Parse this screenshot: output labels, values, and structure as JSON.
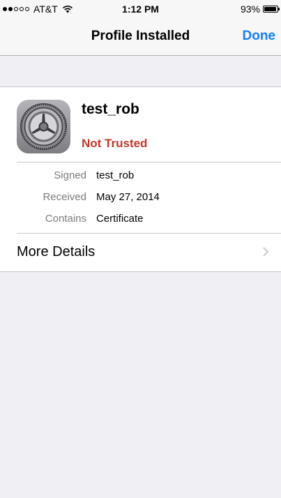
{
  "status": {
    "carrier": "AT&T",
    "signal_bars_filled": 2,
    "signal_bars_total": 5,
    "time": "1:12 PM",
    "battery": "93%",
    "battery_level": 0.93
  },
  "nav": {
    "title": "Profile Installed",
    "done_label": "Done"
  },
  "profile": {
    "icon": "settings-gear-icon",
    "name": "test_rob",
    "trust_status": "Not Trusted",
    "details": [
      {
        "label": "Signed",
        "value": "test_rob"
      },
      {
        "label": "Received",
        "value": "May 27, 2014"
      },
      {
        "label": "Contains",
        "value": "Certificate"
      }
    ],
    "more_details_label": "More Details"
  },
  "colors": {
    "accent": "#147efb",
    "warning": "#c0392b",
    "background": "#efeff4"
  }
}
